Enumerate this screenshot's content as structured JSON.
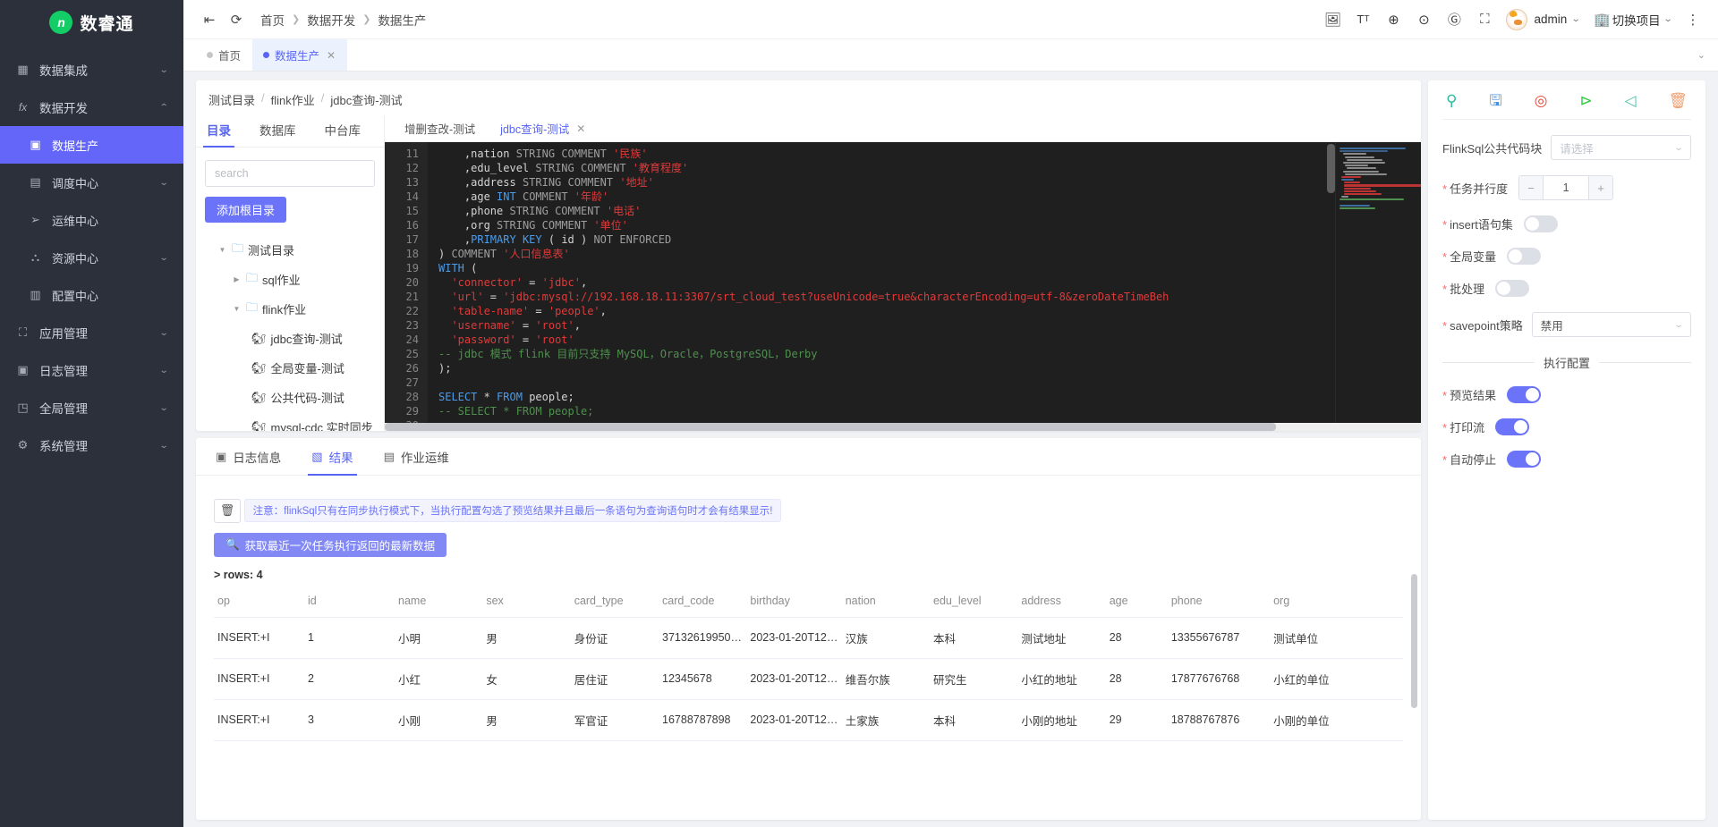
{
  "brand": {
    "name": "数睿通",
    "logo_letter": "n"
  },
  "sidebar": {
    "items": [
      {
        "label": "数据集成",
        "icon": "grid-icon",
        "arrow": "chevron-down",
        "level": 0,
        "active": false
      },
      {
        "label": "数据开发",
        "icon": "fx-icon",
        "arrow": "chevron-up",
        "level": 0,
        "active": false
      },
      {
        "label": "数据生产",
        "icon": "monitor-icon",
        "arrow": "",
        "level": 1,
        "active": true
      },
      {
        "label": "调度中心",
        "icon": "calendar-icon",
        "arrow": "chevron-down",
        "level": 1,
        "active": false
      },
      {
        "label": "运维中心",
        "icon": "send-icon",
        "arrow": "",
        "level": 1,
        "active": false
      },
      {
        "label": "资源中心",
        "icon": "sitemap-icon",
        "arrow": "chevron-down",
        "level": 1,
        "active": false
      },
      {
        "label": "配置中心",
        "icon": "box-icon",
        "arrow": "",
        "level": 1,
        "active": false
      },
      {
        "label": "应用管理",
        "icon": "apps-icon",
        "arrow": "chevron-down",
        "level": 0,
        "active": false
      },
      {
        "label": "日志管理",
        "icon": "log-icon",
        "arrow": "chevron-down",
        "level": 0,
        "active": false
      },
      {
        "label": "全局管理",
        "icon": "global-icon",
        "arrow": "chevron-down",
        "level": 0,
        "active": false
      },
      {
        "label": "系统管理",
        "icon": "gear-icon",
        "arrow": "chevron-down",
        "level": 0,
        "active": false
      }
    ]
  },
  "topbar": {
    "collapse_icon": "collapse-menu-icon",
    "refresh_icon": "refresh-icon",
    "breadcrumb": [
      "首页",
      "数据开发",
      "数据生产"
    ],
    "right_icons": [
      "image-add-icon",
      "font-size-icon",
      "globe-icon",
      "github-icon",
      "gitee-icon",
      "fullscreen-icon"
    ],
    "user_name": "admin",
    "project_switch": "切换项目",
    "more_icon": "more-vertical-icon"
  },
  "page_tabs": [
    {
      "label": "首页",
      "active": false,
      "closable": false
    },
    {
      "label": "数据生产",
      "active": true,
      "closable": true
    }
  ],
  "editor": {
    "path": [
      "测试目录",
      "flink作业",
      "jdbc查询-测试"
    ],
    "tree_tabs": [
      {
        "label": "目录",
        "active": true
      },
      {
        "label": "数据库",
        "active": false
      },
      {
        "label": "中台库",
        "active": false
      }
    ],
    "search_placeholder": "search",
    "add_root_label": "添加根目录",
    "tree": [
      {
        "label": "测试目录",
        "type": "folder",
        "level": 0,
        "expanded": true
      },
      {
        "label": "sql作业",
        "type": "folder",
        "level": 1,
        "expanded": false
      },
      {
        "label": "flink作业",
        "type": "folder",
        "level": 1,
        "expanded": true
      },
      {
        "label": "jdbc查询-测试",
        "type": "file",
        "level": 2,
        "expanded": null
      },
      {
        "label": "全局变量-测试",
        "type": "file",
        "level": 2,
        "expanded": null
      },
      {
        "label": "公共代码-测试",
        "type": "file",
        "level": 2,
        "expanded": null
      },
      {
        "label": "mysql-cdc 实时同步",
        "type": "file",
        "level": 2,
        "expanded": null
      }
    ],
    "editor_tabs": [
      {
        "label": "增删查改-测试",
        "active": false,
        "closable": false
      },
      {
        "label": "jdbc查询-测试",
        "active": true,
        "closable": true
      }
    ],
    "first_line_no": 11,
    "code_lines": [
      "    ,nation STRING COMMENT '民族'",
      "    ,edu_level STRING COMMENT '教育程度'",
      "    ,address STRING COMMENT '地址'",
      "    ,age INT COMMENT '年龄'",
      "    ,phone STRING COMMENT '电话'",
      "    ,org STRING COMMENT '单位'",
      "    ,PRIMARY KEY ( id ) NOT ENFORCED",
      ") COMMENT '人口信息表'",
      "WITH (",
      "  'connector' = 'jdbc',",
      "  'url' = 'jdbc:mysql://192.168.18.11:3307/srt_cloud_test?useUnicode=true&characterEncoding=utf-8&zeroDateTimeBeh",
      "  'table-name' = 'people',",
      "  'username' = 'root',",
      "  'password' = 'root'",
      "-- jdbc 模式 flink 目前只支持 MySQL，Oracle，PostgreSQL，Derby",
      ");",
      "",
      "SELECT * FROM people;",
      "-- SELECT * FROM people;",
      ""
    ]
  },
  "results": {
    "tabs": [
      {
        "label": "日志信息",
        "icon": "log-panel-icon",
        "active": false
      },
      {
        "label": "结果",
        "icon": "result-icon",
        "active": true
      },
      {
        "label": "作业运维",
        "icon": "ops-icon",
        "active": false
      }
    ],
    "clear_icon": "trash-icon",
    "notice": "注意：flinkSql只有在同步执行模式下，当执行配置勾选了预览结果并且最后一条语句为查询语句时才会有结果显示!",
    "fetch_button": {
      "label": "获取最近一次任务执行返回的最新数据",
      "icon": "search-icon"
    },
    "rows_label": "> rows: 4",
    "columns": [
      "op",
      "id",
      "name",
      "sex",
      "card_type",
      "card_code",
      "birthday",
      "nation",
      "edu_level",
      "address",
      "age",
      "phone",
      "org"
    ],
    "rows": [
      [
        "INSERT:+I",
        "1",
        "小明",
        "男",
        "身份证",
        "371326199503...",
        "2023-01-20T12:...",
        "汉族",
        "本科",
        "测试地址",
        "28",
        "13355676787",
        "测试单位"
      ],
      [
        "INSERT:+I",
        "2",
        "小红",
        "女",
        "居住证",
        "12345678",
        "2023-01-20T12:...",
        "维吾尔族",
        "研究生",
        "小红的地址",
        "28",
        "17877676768",
        "小红的单位"
      ],
      [
        "INSERT:+I",
        "3",
        "小刚",
        "男",
        "军官证",
        "16788787898",
        "2023-01-20T12:...",
        "土家族",
        "本科",
        "小刚的地址",
        "29",
        "18788767876",
        "小刚的单位"
      ]
    ]
  },
  "config": {
    "toolbar_icons": [
      {
        "name": "magic-wand-icon",
        "glyph": "✦",
        "color": "#2bbd9e"
      },
      {
        "name": "save-icon",
        "glyph": "▤",
        "color": "#4a90d9"
      },
      {
        "name": "check-syntax-icon",
        "glyph": "◎",
        "color": "#e74c3c"
      },
      {
        "name": "run-icon",
        "glyph": "▶",
        "color": "#2ecc40"
      },
      {
        "name": "publish-icon",
        "glyph": "➤",
        "color": "#4cc2a8"
      },
      {
        "name": "delete-icon",
        "glyph": "▥",
        "color": "#f0a070"
      }
    ],
    "rows": [
      {
        "label": "FlinkSql公共代码块",
        "required": false,
        "type": "select",
        "value": "请选择",
        "placeholder": true
      },
      {
        "label": "任务并行度",
        "required": true,
        "type": "stepper",
        "value": "1"
      },
      {
        "label": "insert语句集",
        "required": true,
        "type": "switch",
        "value": false
      },
      {
        "label": "全局变量",
        "required": true,
        "type": "switch",
        "value": false
      },
      {
        "label": "批处理",
        "required": true,
        "type": "switch",
        "value": false
      },
      {
        "label": "savepoint策略",
        "required": true,
        "type": "select",
        "value": "禁用",
        "placeholder": false
      }
    ],
    "section_title": "执行配置",
    "exec_rows": [
      {
        "label": "预览结果",
        "required": true,
        "type": "switch",
        "value": true
      },
      {
        "label": "打印流",
        "required": true,
        "type": "switch",
        "value": true
      },
      {
        "label": "自动停止",
        "required": true,
        "type": "switch",
        "value": true
      }
    ]
  }
}
